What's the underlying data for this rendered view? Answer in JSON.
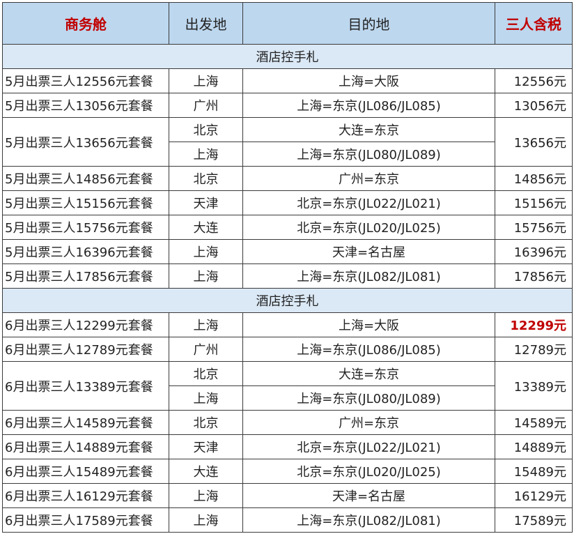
{
  "header": {
    "col1": "商务舱",
    "col2": "出发地",
    "col3": "目的地",
    "col4": "三人含税",
    "accent_color": "#c00000",
    "header_bg": "#bdd7ee",
    "section_bg": "#dbe9f6"
  },
  "sections": [
    {
      "title": "酒店控手札",
      "rows": [
        {
          "pkg": "5月出票三人12556元套餐",
          "price": "12556元",
          "legs": [
            {
              "from": "上海",
              "to": "上海=大阪"
            }
          ]
        },
        {
          "pkg": "5月出票三人13056元套餐",
          "price": "13056元",
          "legs": [
            {
              "from": "广州",
              "to": "上海=东京(JL086/JL085)"
            }
          ]
        },
        {
          "pkg": "5月出票三人13656元套餐",
          "price": "13656元",
          "legs": [
            {
              "from": "北京",
              "to": "大连=东京"
            },
            {
              "from": "上海",
              "to": "上海=东京(JL080/JL089)"
            }
          ]
        },
        {
          "pkg": "5月出票三人14856元套餐",
          "price": "14856元",
          "legs": [
            {
              "from": "北京",
              "to": "广州=东京"
            }
          ]
        },
        {
          "pkg": "5月出票三人15156元套餐",
          "price": "15156元",
          "legs": [
            {
              "from": "天津",
              "to": "北京=东京(JL022/JL021)"
            }
          ]
        },
        {
          "pkg": "5月出票三人15756元套餐",
          "price": "15756元",
          "legs": [
            {
              "from": "大连",
              "to": "北京=东京(JL020/JL025)"
            }
          ]
        },
        {
          "pkg": "5月出票三人16396元套餐",
          "price": "16396元",
          "legs": [
            {
              "from": "上海",
              "to": "天津=名古屋"
            }
          ]
        },
        {
          "pkg": "5月出票三人17856元套餐",
          "price": "17856元",
          "legs": [
            {
              "from": "上海",
              "to": "上海=东京(JL082/JL081)"
            }
          ]
        }
      ]
    },
    {
      "title": "酒店控手札",
      "rows": [
        {
          "pkg": "6月出票三人12299元套餐",
          "price": "12299元",
          "highlight": true,
          "legs": [
            {
              "from": "上海",
              "to": "上海=大阪"
            }
          ]
        },
        {
          "pkg": "6月出票三人12789元套餐",
          "price": "12789元",
          "legs": [
            {
              "from": "广州",
              "to": "上海=东京(JL086/JL085)"
            }
          ]
        },
        {
          "pkg": "6月出票三人13389元套餐",
          "price": "13389元",
          "legs": [
            {
              "from": "北京",
              "to": "大连=东京"
            },
            {
              "from": "上海",
              "to": "上海=东京(JL080/JL089)"
            }
          ]
        },
        {
          "pkg": "6月出票三人14589元套餐",
          "price": "14589元",
          "legs": [
            {
              "from": "北京",
              "to": "广州=东京"
            }
          ]
        },
        {
          "pkg": "6月出票三人14889元套餐",
          "price": "14889元",
          "legs": [
            {
              "from": "天津",
              "to": "北京=东京(JL022/JL021)"
            }
          ]
        },
        {
          "pkg": "6月出票三人15489元套餐",
          "price": "15489元",
          "legs": [
            {
              "from": "大连",
              "to": "北京=东京(JL020/JL025)"
            }
          ]
        },
        {
          "pkg": "6月出票三人16129元套餐",
          "price": "16129元",
          "legs": [
            {
              "from": "上海",
              "to": "天津=名古屋"
            }
          ]
        },
        {
          "pkg": "6月出票三人17589元套餐",
          "price": "17589元",
          "legs": [
            {
              "from": "上海",
              "to": "上海=东京(JL082/JL081)"
            }
          ]
        }
      ]
    }
  ]
}
